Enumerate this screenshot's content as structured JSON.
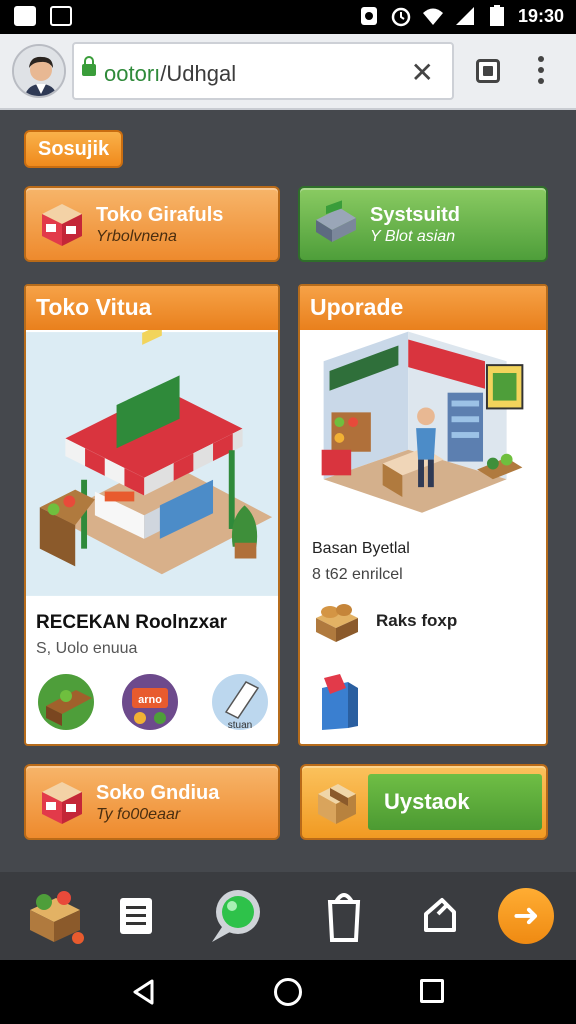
{
  "status_bar": {
    "time": "19:30"
  },
  "browser": {
    "url_primary": "ootorı",
    "url_secondary": "/Udhgal",
    "close_glyph": "✕"
  },
  "chip": {
    "label": "Sosujik"
  },
  "tiles": [
    {
      "title": "Toko Girafuls",
      "subtitle": "Yrbolvnena",
      "icon": "store-box-icon"
    },
    {
      "title": "Systsuitd",
      "subtitle": "Y Blot asian",
      "icon": "cash-register-icon"
    }
  ],
  "panel_left": {
    "header": "Toko Vitua",
    "shop_name": "RECEKAN Roolnzxar",
    "shop_sub": "S, Uolo enuua",
    "badges": [
      "plant-box-icon",
      "sale-sign-icon",
      "receipt-icon"
    ],
    "badge_label": "arno",
    "badge_paper_label": "stuan"
  },
  "panel_right": {
    "header": "Uporade",
    "item_name": "Basan Byetlal",
    "item_sub": "8 t62 enrilcel",
    "feature_label": "Raks foxp",
    "feature_icon": "bread-crate-icon",
    "bag_icon": "shopping-bag-icon"
  },
  "bottom_tiles": [
    {
      "title": "Soko Gndiua",
      "subtitle": "Ty fo00eaar",
      "icon": "store-box-icon"
    },
    {
      "label": "Uystaok",
      "icon": "package-icon"
    }
  ],
  "appbar": {
    "icons": [
      "shop-cart-icon",
      "document-icon",
      "chat-bubble-icon",
      "shopping-bag-icon",
      "edit-icon"
    ],
    "next_glyph": "➜"
  },
  "colors": {
    "accent_orange": "#f08a1c",
    "accent_green": "#4e9e3a",
    "background": "#45484d"
  }
}
